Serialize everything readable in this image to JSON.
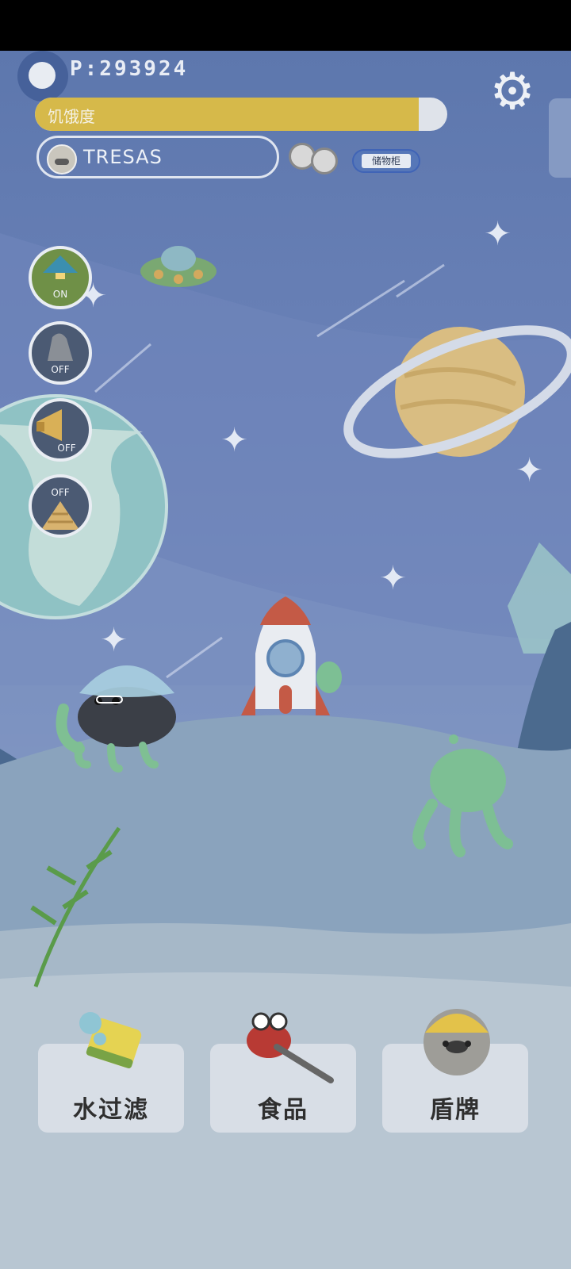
{
  "hud": {
    "score": "P:293924",
    "hunger_label": "饥饿度",
    "hunger_level": 0.93,
    "pet_name": "TRESAS",
    "locker_label": "储物柜"
  },
  "toggles": [
    {
      "name": "lamp-toggle",
      "icon": "lamp-icon",
      "state": "ON"
    },
    {
      "name": "rock-toggle",
      "icon": "rock-icon",
      "state": "OFF"
    },
    {
      "name": "megaphone-toggle",
      "icon": "megaphone-icon",
      "state": "OFF"
    },
    {
      "name": "shell-toggle",
      "icon": "shell-icon",
      "state": "OFF"
    }
  ],
  "bottom_buttons": [
    {
      "name": "water-filter-button",
      "icon": "sponge-icon",
      "label": "水过滤"
    },
    {
      "name": "food-button",
      "icon": "crab-tongs-icon",
      "label": "食品"
    },
    {
      "name": "shield-button",
      "icon": "helmet-seal-icon",
      "label": "盾牌"
    }
  ],
  "colors": {
    "hunger_fill": "#d6b94a",
    "background_top": "#5d77ad",
    "background_bottom": "#a9b8c8"
  }
}
